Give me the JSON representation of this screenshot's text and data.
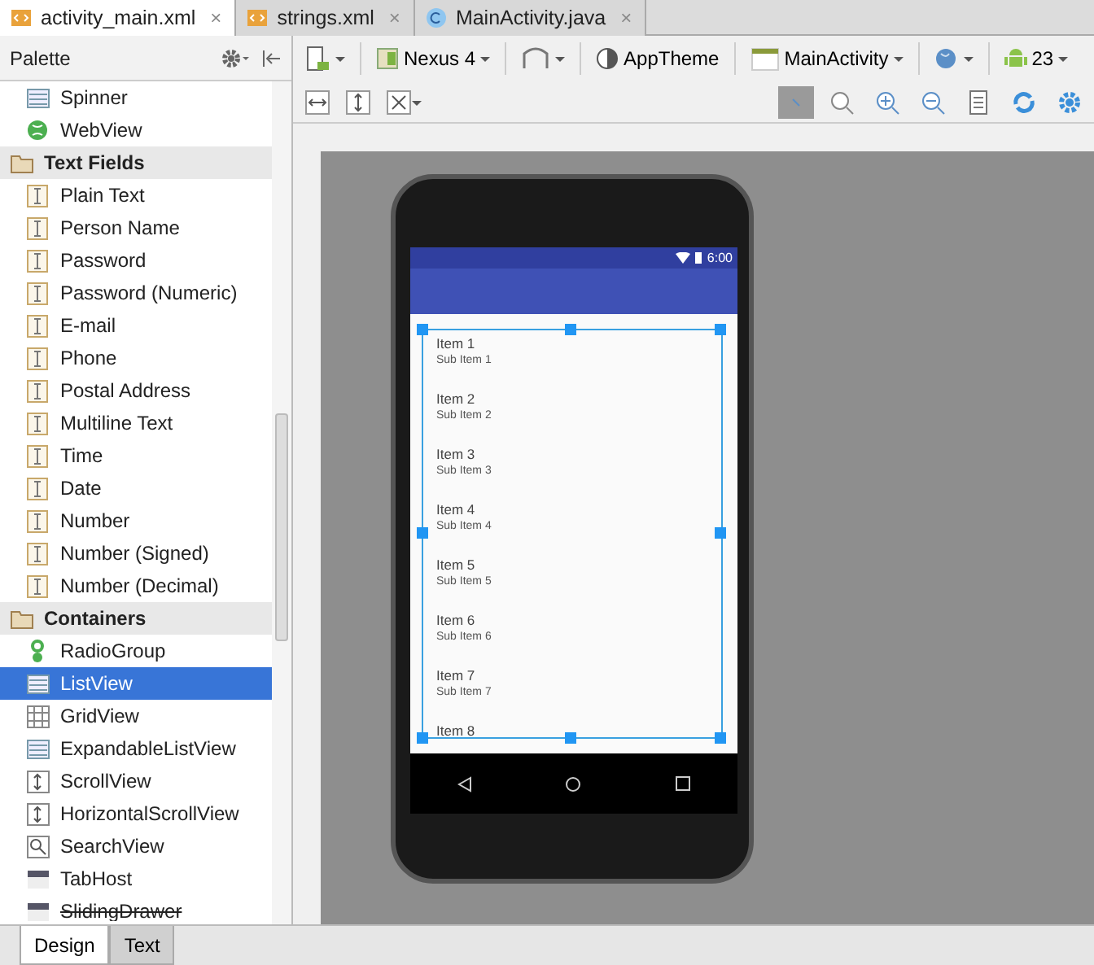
{
  "editor_tabs": [
    {
      "label": "activity_main.xml",
      "kind": "xml",
      "selected": true,
      "close": "×"
    },
    {
      "label": "strings.xml",
      "kind": "xml",
      "selected": false,
      "close": "×"
    },
    {
      "label": "MainActivity.java",
      "kind": "class",
      "selected": false,
      "close": "×"
    }
  ],
  "palette": {
    "title": "Palette",
    "items": [
      {
        "label": "Spinner",
        "kind": "widget",
        "selected": false
      },
      {
        "label": "WebView",
        "kind": "web",
        "selected": false
      },
      {
        "label": "Text Fields",
        "kind": "category",
        "selected": false
      },
      {
        "label": "Plain Text",
        "kind": "text-field",
        "selected": false
      },
      {
        "label": "Person Name",
        "kind": "text-field",
        "selected": false
      },
      {
        "label": "Password",
        "kind": "text-field",
        "selected": false
      },
      {
        "label": "Password (Numeric)",
        "kind": "text-field",
        "selected": false
      },
      {
        "label": "E-mail",
        "kind": "text-field",
        "selected": false
      },
      {
        "label": "Phone",
        "kind": "text-field",
        "selected": false
      },
      {
        "label": "Postal Address",
        "kind": "text-field",
        "selected": false
      },
      {
        "label": "Multiline Text",
        "kind": "text-field",
        "selected": false
      },
      {
        "label": "Time",
        "kind": "text-field",
        "selected": false
      },
      {
        "label": "Date",
        "kind": "text-field",
        "selected": false
      },
      {
        "label": "Number",
        "kind": "text-field",
        "selected": false
      },
      {
        "label": "Number (Signed)",
        "kind": "text-field",
        "selected": false
      },
      {
        "label": "Number (Decimal)",
        "kind": "text-field",
        "selected": false
      },
      {
        "label": "Containers",
        "kind": "category",
        "selected": false
      },
      {
        "label": "RadioGroup",
        "kind": "radio",
        "selected": false
      },
      {
        "label": "ListView",
        "kind": "widget",
        "selected": true
      },
      {
        "label": "GridView",
        "kind": "grid",
        "selected": false
      },
      {
        "label": "ExpandableListView",
        "kind": "widget",
        "selected": false
      },
      {
        "label": "ScrollView",
        "kind": "scroll",
        "selected": false
      },
      {
        "label": "HorizontalScrollView",
        "kind": "scroll",
        "selected": false
      },
      {
        "label": "SearchView",
        "kind": "search",
        "selected": false
      },
      {
        "label": "TabHost",
        "kind": "tabs",
        "selected": false
      },
      {
        "label": "SlidingDrawer",
        "kind": "tabs",
        "selected": false,
        "deprecated": true
      }
    ]
  },
  "toolbar": {
    "device": "Nexus 4",
    "theme": "AppTheme",
    "activity": "MainActivity",
    "api": "23"
  },
  "phone": {
    "time": "6:00",
    "list": [
      {
        "title": "Item 1",
        "subtitle": "Sub Item 1"
      },
      {
        "title": "Item 2",
        "subtitle": "Sub Item 2"
      },
      {
        "title": "Item 3",
        "subtitle": "Sub Item 3"
      },
      {
        "title": "Item 4",
        "subtitle": "Sub Item 4"
      },
      {
        "title": "Item 5",
        "subtitle": "Sub Item 5"
      },
      {
        "title": "Item 6",
        "subtitle": "Sub Item 6"
      },
      {
        "title": "Item 7",
        "subtitle": "Sub Item 7"
      },
      {
        "title": "Item 8"
      }
    ]
  },
  "bottom_tabs": [
    {
      "label": "Design",
      "selected": true
    },
    {
      "label": "Text",
      "selected": false
    }
  ]
}
